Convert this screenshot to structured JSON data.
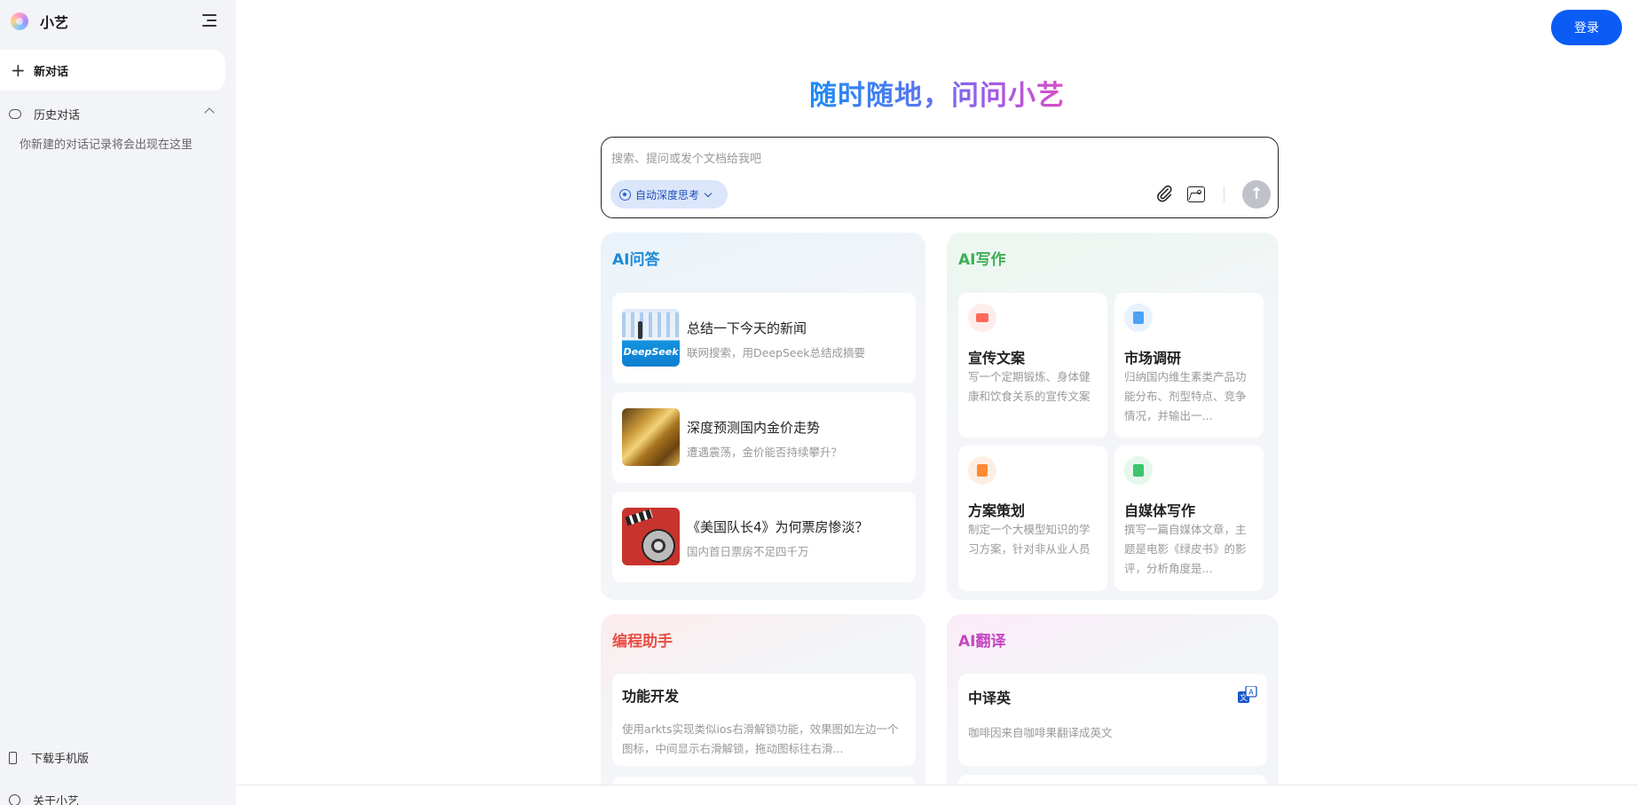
{
  "sidebar": {
    "brand": "小艺",
    "new_chat": "新对话",
    "history_label": "历史对话",
    "history_empty": "你新建的对话记录将会出现在这里",
    "download": "下载手机版",
    "about": "关于小艺"
  },
  "header": {
    "login": "登录"
  },
  "hero": {
    "title": "随时随地，问问小艺"
  },
  "composer": {
    "placeholder": "搜索、提问或发个文档给我吧",
    "think_chip": "自动深度思考"
  },
  "qa": {
    "title": "AI问答",
    "items": [
      {
        "title": "总结一下今天的新闻",
        "sub": "联网搜索，用DeepSeek总结成摘要",
        "thumb": "DeepSeek"
      },
      {
        "title": "深度预测国内金价走势",
        "sub": "遭遇震荡，金价能否持续攀升？"
      },
      {
        "title": "《美国队长4》为何票房惨淡？",
        "sub": "国内首日票房不足四千万"
      }
    ]
  },
  "writing": {
    "title": "AI写作",
    "items": [
      {
        "title": "宣传文案",
        "sub": "写一个定期锻炼、身体健康和饮食关系的宣传文案",
        "color": "#ff6a5c",
        "bg": "#fdecec"
      },
      {
        "title": "市场调研",
        "sub": "归纳国内维生素类产品功能分布、剂型特点、竞争情况，并输出一...",
        "color": "#4aa3f3",
        "bg": "#e7f2fd"
      },
      {
        "title": "方案策划",
        "sub": "制定一个大模型知识的学习方案，针对非从业人员",
        "color": "#ff8a34",
        "bg": "#fdeee3"
      },
      {
        "title": "自媒体写作",
        "sub": "撰写一篇自媒体文章，主题是电影《绿皮书》的影评，分析角度是...",
        "color": "#3ec46d",
        "bg": "#e6f7ec"
      }
    ]
  },
  "coding": {
    "title": "编程助手",
    "item": {
      "title": "功能开发",
      "sub": "使用arkts实现类似ios右滑解锁功能，效果图如左边一个图标，中间显示右滑解锁，拖动图标往右滑..."
    }
  },
  "translate": {
    "title": "AI翻译",
    "item": {
      "title": "中译英",
      "sub": "咖啡因来自咖啡果翻译成英文"
    }
  },
  "colors": {
    "qa": "#1b8bd6",
    "writing": "#3fae57",
    "coding": "#e84d44",
    "translate": "#c247c2",
    "accent": "#0b5cf5"
  }
}
